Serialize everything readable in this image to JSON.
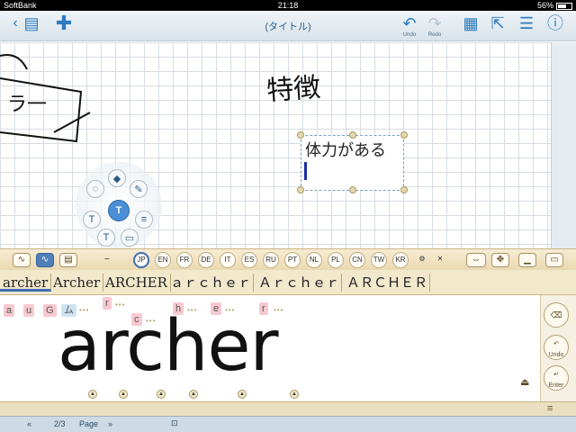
{
  "status": {
    "carrier": "SoftBank",
    "time": "21:18",
    "battery": "56%",
    "battery_level": 0.56
  },
  "toolbar": {
    "title": "(タイトル)",
    "undo_label": "Undo",
    "redo_label": "Redo",
    "icons": [
      "back-icon",
      "notebook-icon",
      "add-icon",
      "undo-icon",
      "redo-icon",
      "pages-icon",
      "export-icon",
      "menu-icon",
      "info-icon"
    ]
  },
  "canvas": {
    "handwritten_note": "特徴",
    "textbox_text": "体力がある",
    "handwritten_partial": "ラ一"
  },
  "radial_menu": {
    "center_label": "T",
    "items": [
      "lasso-icon",
      "eraser-icon",
      "pen-icon",
      "text-style-icon",
      "list-icon",
      "keyboard-icon",
      "text-box-icon"
    ]
  },
  "lang_bar": {
    "languages": [
      "JP",
      "EN",
      "FR",
      "DE",
      "IT",
      "ES",
      "RU",
      "PT",
      "NL",
      "PL",
      "CN",
      "TW",
      "KR"
    ],
    "selected": "JP",
    "icons": [
      "stroke-mode-icon",
      "handwriting-mode-icon",
      "keyboard-mode-icon",
      "curve-icon",
      "settings-icon",
      "close-icon",
      "move-icon",
      "pan-icon",
      "minimize-icon",
      "resize-icon"
    ]
  },
  "candidates": [
    "archer",
    "Archer",
    "ARCHER",
    "ａｒｃｈｅｒ",
    "Ａｒｃｈｅｒ",
    "ＡＲＣＨＥＲ"
  ],
  "char_chips": {
    "row1": [
      "a",
      "u",
      "G",
      "ム"
    ],
    "letters": [
      "r",
      "c",
      "h",
      "e",
      "r"
    ]
  },
  "ink_text": "archer",
  "side_buttons": {
    "enter_label": "Enter",
    "undo_label": "Undo"
  },
  "bottom": {
    "page": "2/3",
    "page_label": "Page"
  }
}
